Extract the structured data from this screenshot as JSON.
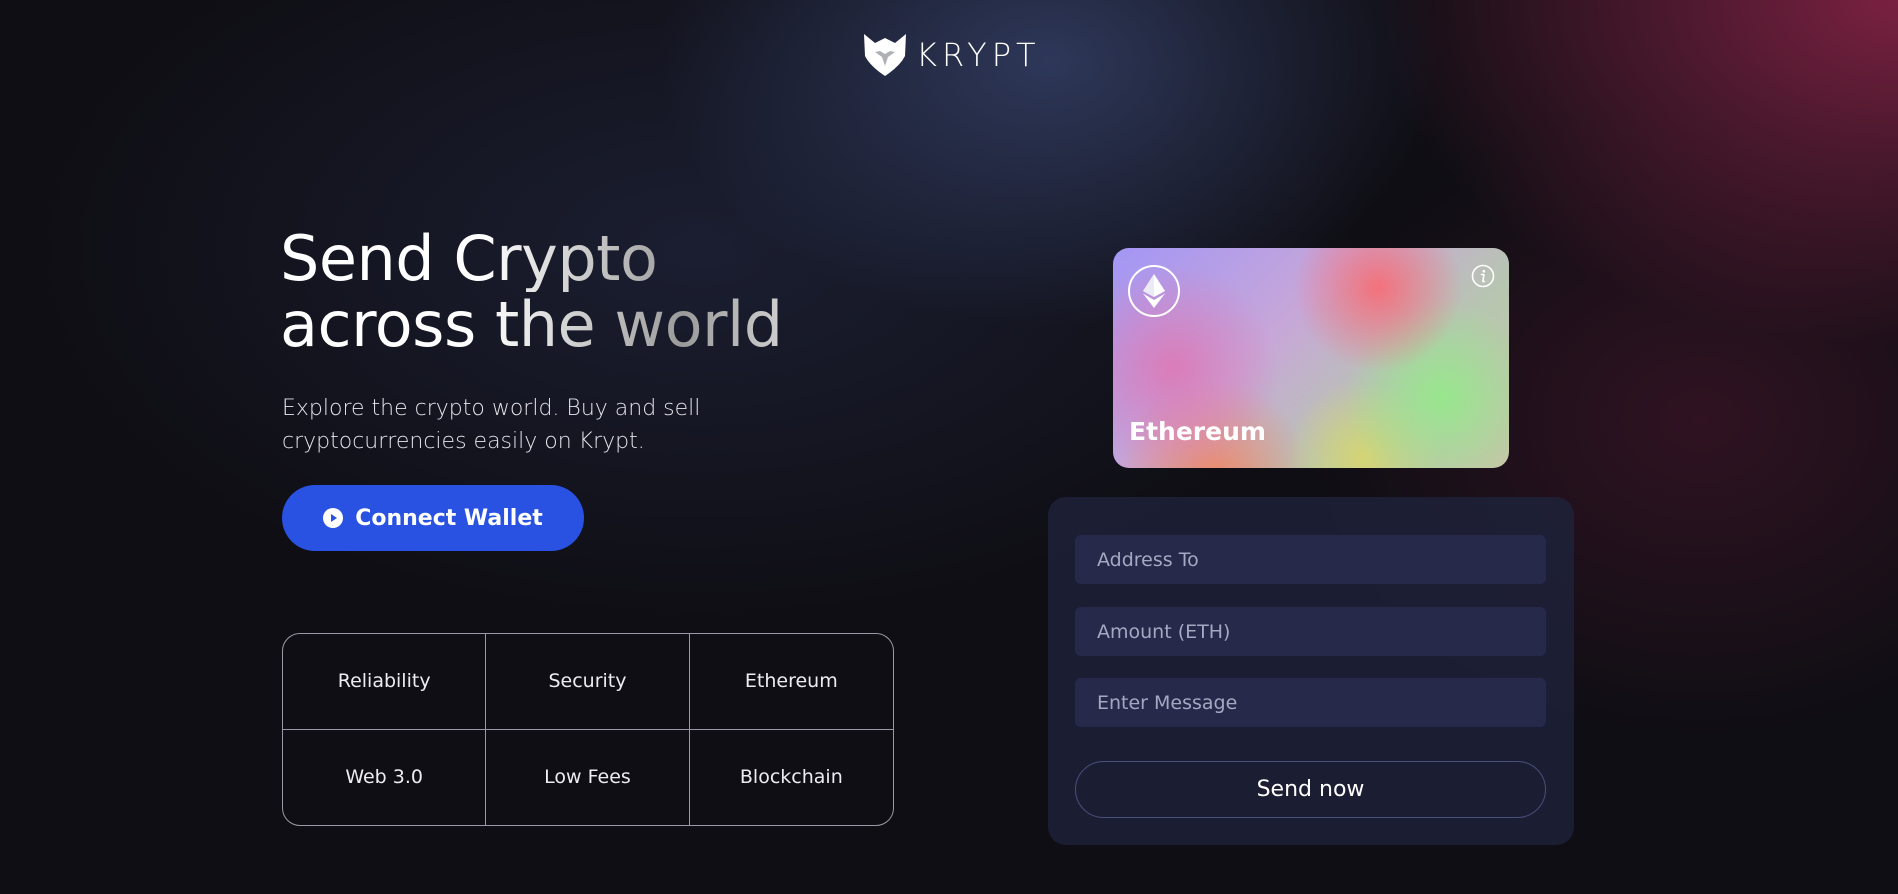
{
  "brand": {
    "name": "KRYPT",
    "logo_icon": "fox-head-icon"
  },
  "hero": {
    "title_line1": "Send Crypto",
    "title_line2": "across the world",
    "subtitle": "Explore the crypto world. Buy and sell cryptocurrencies easily on Krypt.",
    "connect_label": "Connect Wallet",
    "connect_icon": "play-circle-icon"
  },
  "features": [
    "Reliability",
    "Security",
    "Ethereum",
    "Web 3.0",
    "Low Fees",
    "Blockchain"
  ],
  "card": {
    "title": "Ethereum",
    "coin_icon": "ethereum-icon",
    "info_icon": "info-icon"
  },
  "form": {
    "address_placeholder": "Address To",
    "amount_placeholder": "Amount (ETH)",
    "message_placeholder": "Enter Message",
    "send_label": "Send now"
  },
  "colors": {
    "background": "#0f0e14",
    "accent": "#2952e3",
    "panel": "#1e2138",
    "input": "#26294a"
  }
}
